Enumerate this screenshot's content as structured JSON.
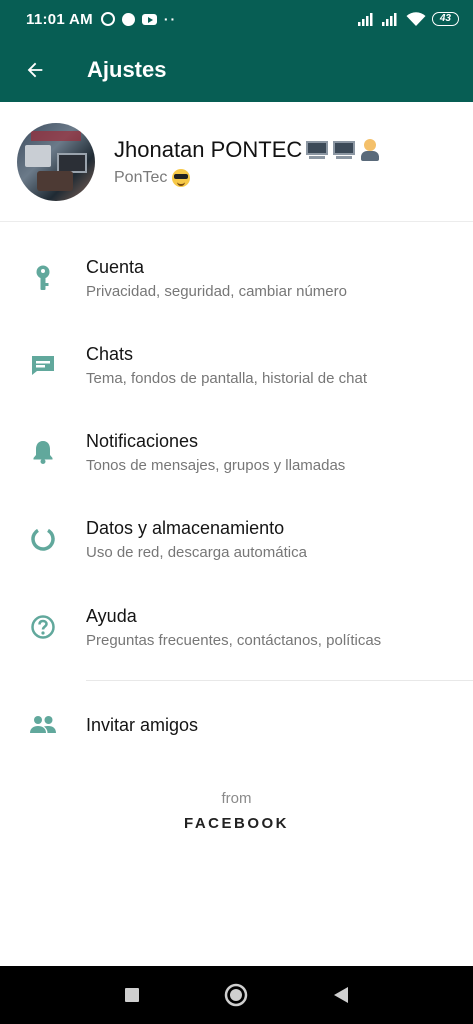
{
  "status_bar": {
    "time": "11:01 AM",
    "battery": "43",
    "left_icons": [
      "alarm-icon",
      "facebook-icon",
      "youtube-icon",
      "more-dots-icon"
    ],
    "right_icons": [
      "signal-icon",
      "signal-icon",
      "wifi-icon",
      "battery-icon"
    ]
  },
  "app_bar": {
    "title": "Ajustes",
    "back_icon": "arrow-back-icon"
  },
  "profile": {
    "name": "Jhonatan PONTEC",
    "name_emojis": [
      "desktop-computer-emoji",
      "laptop-emoji",
      "person-with-laptop-emoji"
    ],
    "status": "PonTec",
    "status_emoji": "smiling-face-with-sunglasses-emoji"
  },
  "menu": {
    "items": [
      {
        "title": "Cuenta",
        "subtitle": "Privacidad, seguridad, cambiar número",
        "icon": "key-icon"
      },
      {
        "title": "Chats",
        "subtitle": "Tema, fondos de pantalla, historial de chat",
        "icon": "chat-icon"
      },
      {
        "title": "Notificaciones",
        "subtitle": "Tonos de mensajes, grupos y llamadas",
        "icon": "bell-icon"
      },
      {
        "title": "Datos y almacenamiento",
        "subtitle": "Uso de red, descarga automática",
        "icon": "data-usage-icon"
      },
      {
        "title": "Ayuda",
        "subtitle": "Preguntas frecuentes, contáctanos, políticas",
        "icon": "help-icon"
      }
    ],
    "invite": {
      "title": "Invitar amigos",
      "icon": "people-icon"
    }
  },
  "footer": {
    "from": "from",
    "brand": "FACEBOOK"
  },
  "nav_bar": {
    "icons": [
      "recents-square-icon",
      "home-circle-icon",
      "back-triangle-icon"
    ]
  },
  "colors": {
    "primary": "#075e54",
    "icon_teal": "#61a89c",
    "text_primary": "#151515",
    "text_secondary": "#777777"
  }
}
